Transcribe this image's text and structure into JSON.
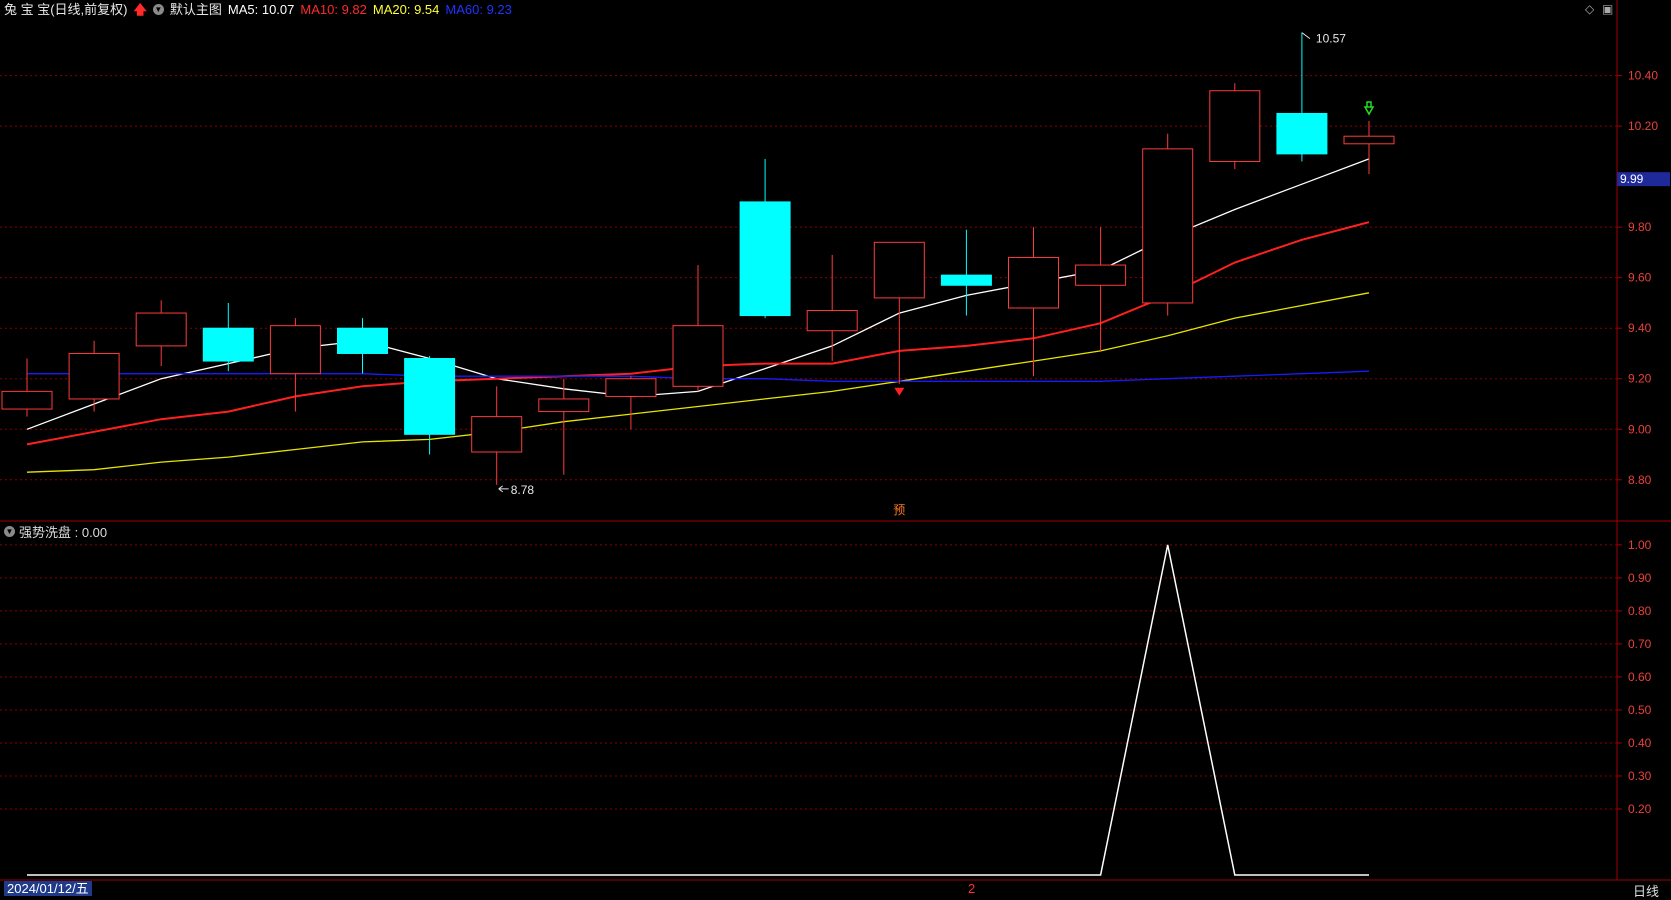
{
  "header": {
    "title": "兔 宝 宝(日线,前复权)",
    "main_chart_name": "默认主图",
    "ma_labels": [
      {
        "text": "MA5: 10.07",
        "color": "#ffffff"
      },
      {
        "text": "MA10: 9.82",
        "color": "#ff2a2a"
      },
      {
        "text": "MA20: 9.54",
        "color": "#ffff33"
      },
      {
        "text": "MA60: 9.23",
        "color": "#2233ff"
      }
    ]
  },
  "sub_indicator": {
    "label": "强势洗盘 : 0.00"
  },
  "footer": {
    "date": "2024/01/12/五",
    "marker": "2",
    "period": "日线"
  },
  "price_axis": {
    "ticks": [
      "10.40",
      "10.20",
      "9.80",
      "9.60",
      "9.40",
      "9.20",
      "9.00",
      "8.80"
    ],
    "current_price": "9.99"
  },
  "sub_axis": {
    "ticks": [
      "1.00",
      "0.90",
      "0.80",
      "0.70",
      "0.60",
      "0.50",
      "0.40",
      "0.30",
      "0.20"
    ]
  },
  "annotations": {
    "high_label": "10.57",
    "low_label": "8.78",
    "pre_label": "预"
  },
  "colors": {
    "up": "#ff3a3a",
    "down": "#00ffff",
    "grid": "#8b0000",
    "ma5": "#ffffff",
    "ma10": "#ff2020",
    "ma20": "#e6e600",
    "ma60": "#1a1aff"
  },
  "chart_data": [
    {
      "type": "candlestick",
      "title": "兔 宝 宝(日线,前复权)",
      "ylim": [
        8.72,
        10.62
      ],
      "candles": [
        {
          "o": 9.08,
          "h": 9.28,
          "l": 9.05,
          "c": 9.15
        },
        {
          "o": 9.12,
          "h": 9.35,
          "l": 9.07,
          "c": 9.3
        },
        {
          "o": 9.33,
          "h": 9.51,
          "l": 9.25,
          "c": 9.46
        },
        {
          "o": 9.4,
          "h": 9.5,
          "l": 9.23,
          "c": 9.27
        },
        {
          "o": 9.22,
          "h": 9.44,
          "l": 9.07,
          "c": 9.41
        },
        {
          "o": 9.4,
          "h": 9.44,
          "l": 9.22,
          "c": 9.3
        },
        {
          "o": 9.28,
          "h": 9.29,
          "l": 8.9,
          "c": 8.98
        },
        {
          "o": 8.91,
          "h": 9.17,
          "l": 8.78,
          "c": 9.05
        },
        {
          "o": 9.07,
          "h": 9.2,
          "l": 8.82,
          "c": 9.12
        },
        {
          "o": 9.13,
          "h": 9.21,
          "l": 9.0,
          "c": 9.2
        },
        {
          "o": 9.17,
          "h": 9.65,
          "l": 9.15,
          "c": 9.41
        },
        {
          "o": 9.9,
          "h": 10.07,
          "l": 9.44,
          "c": 9.45
        },
        {
          "o": 9.39,
          "h": 9.69,
          "l": 9.27,
          "c": 9.47
        },
        {
          "o": 9.52,
          "h": 9.74,
          "l": 9.18,
          "c": 9.74
        },
        {
          "o": 9.61,
          "h": 9.79,
          "l": 9.45,
          "c": 9.57
        },
        {
          "o": 9.48,
          "h": 9.8,
          "l": 9.21,
          "c": 9.68
        },
        {
          "o": 9.57,
          "h": 9.8,
          "l": 9.31,
          "c": 9.65
        },
        {
          "o": 9.5,
          "h": 10.17,
          "l": 9.45,
          "c": 10.11
        },
        {
          "o": 10.06,
          "h": 10.37,
          "l": 10.03,
          "c": 10.34
        },
        {
          "o": 10.25,
          "h": 10.57,
          "l": 10.06,
          "c": 10.09
        },
        {
          "o": 10.13,
          "h": 10.22,
          "l": 10.01,
          "c": 10.16
        }
      ],
      "series": [
        {
          "name": "MA5",
          "values": [
            9.0,
            9.1,
            9.2,
            9.26,
            9.32,
            9.35,
            9.28,
            9.2,
            9.16,
            9.13,
            9.15,
            9.24,
            9.33,
            9.46,
            9.53,
            9.58,
            9.63,
            9.76,
            9.87,
            9.97,
            10.07
          ]
        },
        {
          "name": "MA10",
          "values": [
            8.94,
            8.99,
            9.04,
            9.07,
            9.13,
            9.17,
            9.19,
            9.2,
            9.21,
            9.22,
            9.25,
            9.26,
            9.26,
            9.31,
            9.33,
            9.36,
            9.42,
            9.53,
            9.66,
            9.75,
            9.82
          ]
        },
        {
          "name": "MA20",
          "values": [
            8.83,
            8.84,
            8.87,
            8.89,
            8.92,
            8.95,
            8.96,
            8.99,
            9.03,
            9.06,
            9.09,
            9.12,
            9.15,
            9.19,
            9.23,
            9.27,
            9.31,
            9.37,
            9.44,
            9.49,
            9.54
          ]
        },
        {
          "name": "MA60",
          "values": [
            9.22,
            9.22,
            9.22,
            9.22,
            9.22,
            9.22,
            9.21,
            9.21,
            9.21,
            9.21,
            9.2,
            9.2,
            9.19,
            9.19,
            9.19,
            9.19,
            9.19,
            9.2,
            9.21,
            9.22,
            9.23
          ]
        }
      ]
    },
    {
      "type": "line",
      "title": "强势洗盘",
      "ylim": [
        0,
        1.03
      ],
      "series": [
        {
          "name": "强势洗盘",
          "values": [
            0,
            0,
            0,
            0,
            0,
            0,
            0,
            0,
            0,
            0,
            0,
            0,
            0,
            0,
            0,
            0,
            0,
            1,
            0,
            0,
            0
          ]
        }
      ]
    }
  ]
}
